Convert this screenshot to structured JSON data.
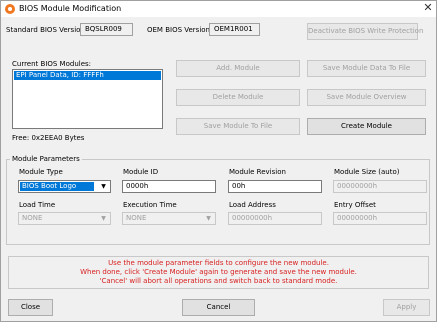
{
  "window": {
    "title": "BIOS Module Modification",
    "close_glyph": "✕"
  },
  "header": {
    "standard_label": "Standard BIOS Version:",
    "standard_value": "BQSLR009",
    "oem_label": "OEM BIOS Version:",
    "oem_value": "OEM1R001",
    "deactivate_button": "Deactivate BIOS Write Protection"
  },
  "modules": {
    "label": "Current BIOS Modules:",
    "items": [
      "EPI Panel Data, ID: FFFFh"
    ],
    "free_text": "Free: 0x2EEA0 Bytes"
  },
  "actions": {
    "add": "Add. Module",
    "save_data": "Save Module Data To File",
    "delete": "Delete Module",
    "save_overview": "Save Module Overview",
    "save_to_file": "Save Module To File",
    "create": "Create Module"
  },
  "params": {
    "group_title": "Module Parameters",
    "module_type_label": "Module Type",
    "module_type_value": "BIOS Boot Logo",
    "module_id_label": "Module ID",
    "module_id_value": "0000h",
    "module_revision_label": "Module Revision",
    "module_revision_value": "00h",
    "module_size_label": "Module Size (auto)",
    "module_size_value": "00000000h",
    "load_time_label": "Load Time",
    "load_time_value": "NONE",
    "execution_time_label": "Execution Time",
    "execution_time_value": "NONE",
    "load_address_label": "Load Address",
    "load_address_value": "00000000h",
    "entry_offset_label": "Entry Offset",
    "entry_offset_value": "00000000h"
  },
  "message": {
    "lines": [
      "Use the module parameter fields to configure the new module.",
      "When done, click 'Create Module' again to generate and save the new module.",
      "'Cancel' will abort all operations and switch back to standard mode."
    ],
    "color": "#d82020"
  },
  "footer": {
    "close": "Close",
    "cancel": "Cancel",
    "apply": "Apply"
  }
}
